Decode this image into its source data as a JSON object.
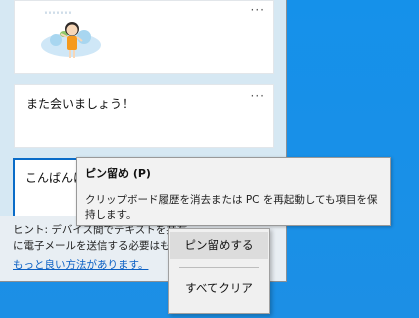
{
  "clipboard": {
    "items": [
      {
        "type": "image",
        "more_label": "···"
      },
      {
        "type": "text",
        "text": "また会いましょう！",
        "more_label": "···"
      },
      {
        "type": "text",
        "text": "こんばんは",
        "more_label": ""
      }
    ],
    "hint": {
      "line1": "ヒント: デバイス間でテキストを共有",
      "line2": "に電子メールを送信する必要はも",
      "link": "もっと良い方法があります。"
    }
  },
  "tooltip": {
    "title": "ピン留め (P)",
    "body": "クリップボード履歴を消去または PC を再起動しても項目を保持します。"
  },
  "context_menu": {
    "items": [
      {
        "label": "ピン留めする"
      },
      {
        "label": "すべてクリア"
      }
    ]
  },
  "colors": {
    "desktop": "#1a8fe6",
    "panel": "#d6e8f3",
    "focus_border": "#0a6cc8",
    "link": "#0b60c4"
  }
}
